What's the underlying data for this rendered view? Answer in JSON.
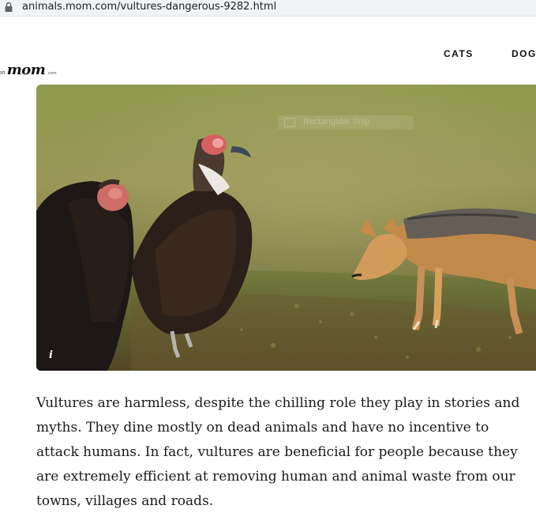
{
  "browser": {
    "url": "animals.mom.com/vultures-dangerous-9282.html",
    "lock_icon": "lock-icon"
  },
  "header": {
    "logo": {
      "prefix": "on",
      "main": "mom",
      "suffix": ".com"
    },
    "nav": [
      {
        "label": "CATS"
      },
      {
        "label": "DOG"
      }
    ]
  },
  "hero": {
    "description_icon": "info-icon",
    "info_label": "i",
    "overlay_hint": "Rectangular Snip"
  },
  "article": {
    "paragraph": "Vultures are harmless, despite the chilling role they play in stories and myths. They dine mostly on dead animals and have no incentive to attack humans. In fact, vultures are beneficial for people because they are extremely efficient at removing human and animal waste from our towns, villages and roads."
  },
  "colors": {
    "text": "#1a1a1a",
    "url_bar": "#f1f3f4"
  }
}
